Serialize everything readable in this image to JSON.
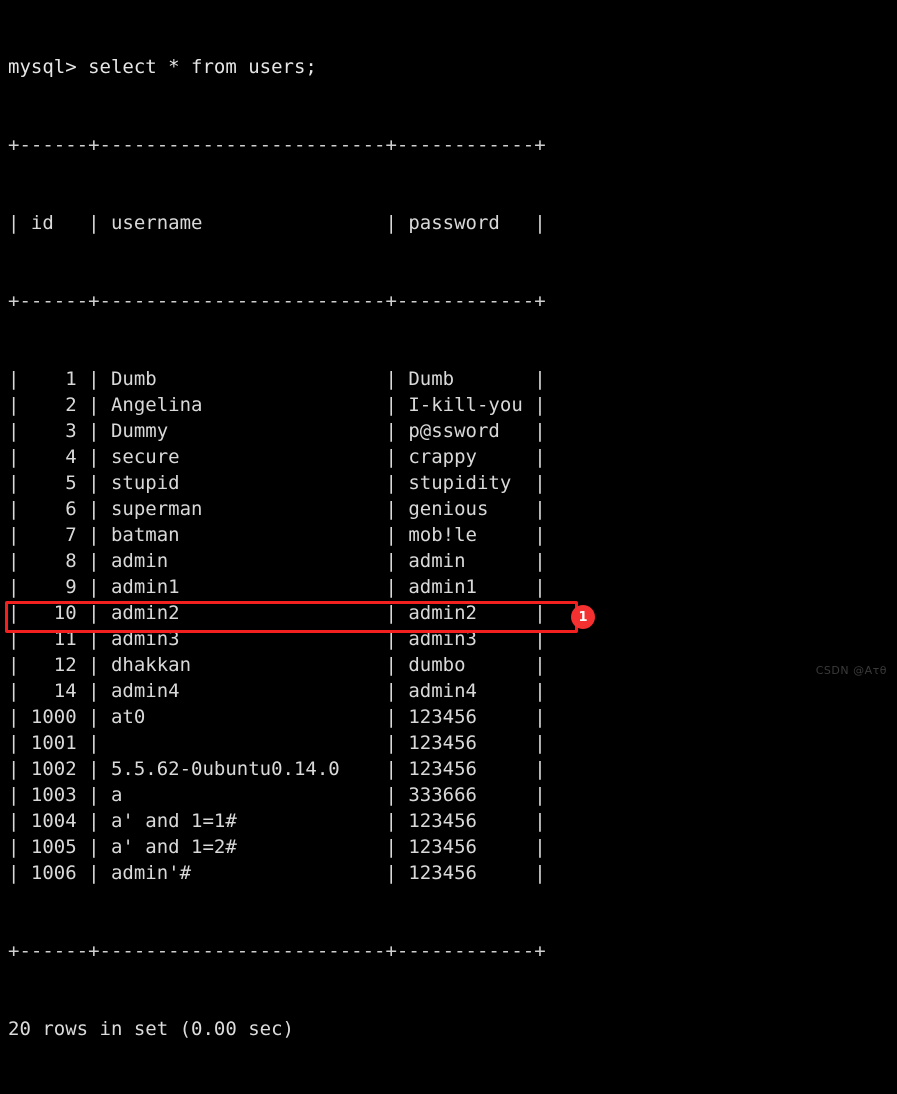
{
  "terminal": {
    "prompt": "mysql>",
    "command": "select * from users;",
    "prompt_line": "mysql> select * from users;",
    "status_line": "20 rows in set (0.00 sec)",
    "row_count": 20,
    "elapsed": "0.00 sec",
    "foreground_color": "#d9d9d9",
    "background_color": "#000000"
  },
  "table": {
    "columns": [
      {
        "name": "id",
        "width": 6,
        "align": "right"
      },
      {
        "name": "username",
        "width": 25,
        "align": "left"
      },
      {
        "name": "password",
        "width": 12,
        "align": "left"
      }
    ],
    "separator": "+------+-------------------------+------------+",
    "header_line": "| id   | username                | password   |",
    "rows": [
      {
        "id": "1",
        "username": "Dumb",
        "password": "Dumb"
      },
      {
        "id": "2",
        "username": "Angelina",
        "password": "I-kill-you"
      },
      {
        "id": "3",
        "username": "Dummy",
        "password": "p@ssword"
      },
      {
        "id": "4",
        "username": "secure",
        "password": "crappy"
      },
      {
        "id": "5",
        "username": "stupid",
        "password": "stupidity"
      },
      {
        "id": "6",
        "username": "superman",
        "password": "genious"
      },
      {
        "id": "7",
        "username": "batman",
        "password": "mob!le"
      },
      {
        "id": "8",
        "username": "admin",
        "password": "admin"
      },
      {
        "id": "9",
        "username": "admin1",
        "password": "admin1"
      },
      {
        "id": "10",
        "username": "admin2",
        "password": "admin2"
      },
      {
        "id": "11",
        "username": "admin3",
        "password": "admin3"
      },
      {
        "id": "12",
        "username": "dhakkan",
        "password": "dumbo"
      },
      {
        "id": "14",
        "username": "admin4",
        "password": "admin4"
      },
      {
        "id": "1000",
        "username": "at0",
        "password": "123456"
      },
      {
        "id": "1001",
        "username": "",
        "password": "123456"
      },
      {
        "id": "1002",
        "username": "5.5.62-0ubuntu0.14.0",
        "password": "123456"
      },
      {
        "id": "1003",
        "username": "a",
        "password": "333666"
      },
      {
        "id": "1004",
        "username": "a' and 1=1#",
        "password": "123456"
      },
      {
        "id": "1005",
        "username": "a' and 1=2#",
        "password": "123456"
      },
      {
        "id": "1006",
        "username": "admin'#",
        "password": "123456"
      }
    ]
  },
  "annotation": {
    "badge_label": "1",
    "badge_color": "#f53030",
    "box_color": "#f32020",
    "highlighted_row_id": "1006"
  },
  "watermark": {
    "text": "CSDN @Aτθ"
  }
}
